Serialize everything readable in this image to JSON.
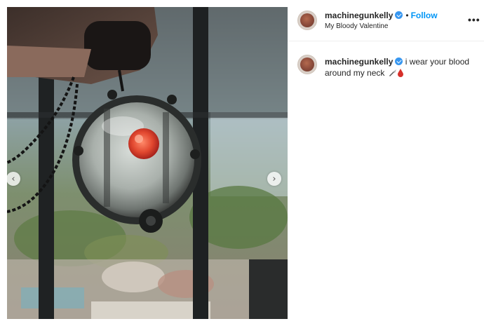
{
  "post": {
    "username": "machinegunkelly",
    "follow_label": "Follow",
    "separator": "•",
    "location": "My Bloody Valentine",
    "more_icon": "more-options-icon",
    "more_label": "•••",
    "caption": {
      "username": "machinegunkelly",
      "text": "i wear your blood around my neck",
      "emojis": [
        "knife-icon",
        "blood-drop-icon"
      ]
    },
    "carousel": {
      "prev_label": "‹",
      "next_label": "›"
    }
  },
  "colors": {
    "follow": "#0095f6",
    "verified": "#3897f0",
    "blood": "#d6302a"
  }
}
